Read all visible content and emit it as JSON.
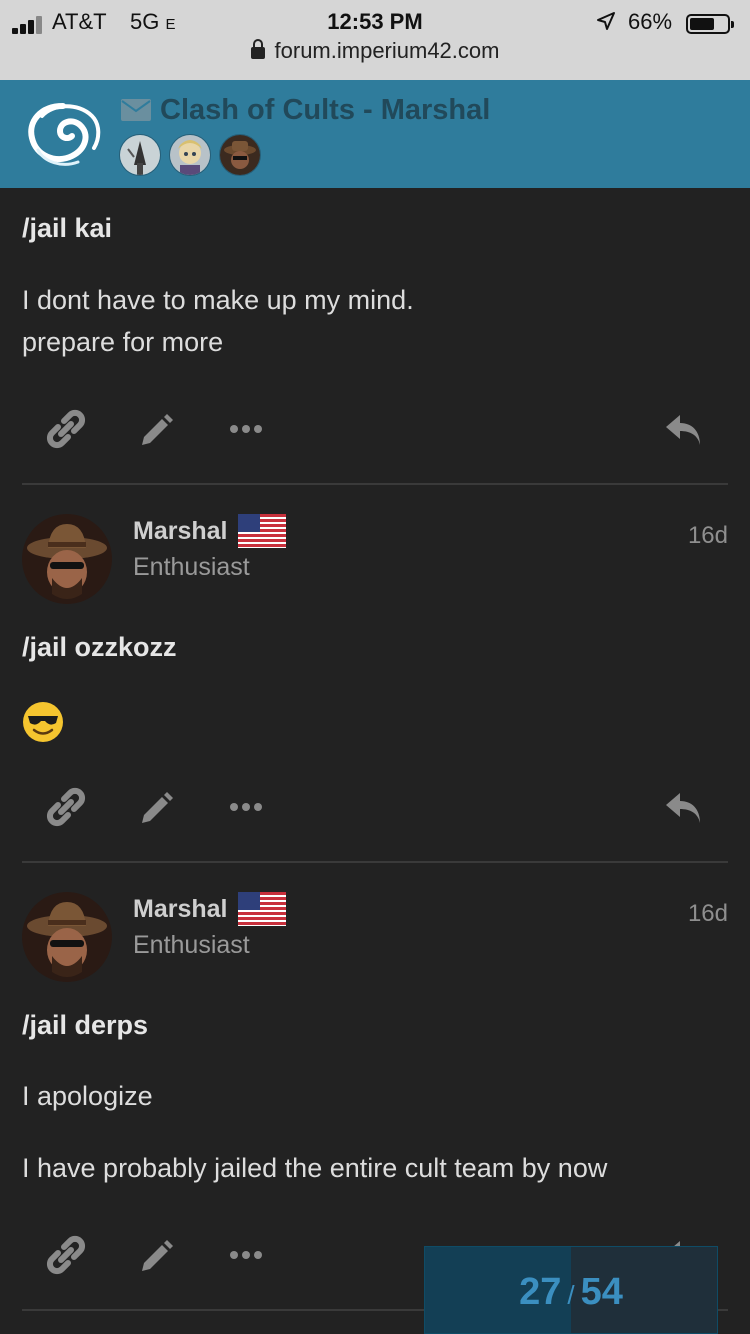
{
  "status_bar": {
    "carrier": "AT&T",
    "network": "5G",
    "network_suffix": "E",
    "time": "12:53 PM",
    "battery_percent": "66%",
    "battery_level": 0.66,
    "url": "forum.imperium42.com"
  },
  "header": {
    "topic_title": "Clash of Cults - Marshal",
    "title_color": "#21495a",
    "bar_color": "#2f7c9c",
    "participants": [
      "participant-avatar-1",
      "participant-avatar-2",
      "participant-avatar-3"
    ]
  },
  "posts": [
    {
      "heading": "/jail kai",
      "lines": [
        "I dont have to make up my mind.",
        "prepare for more"
      ],
      "actions": [
        "link-icon",
        "pencil-icon",
        "more-icon",
        "reply-icon"
      ]
    },
    {
      "username": "Marshal",
      "user_title": "Enthusiast",
      "date": "16d",
      "heading": "/jail ozzkozz",
      "emoji": "sunglasses-emoji",
      "actions": [
        "link-icon",
        "pencil-icon",
        "more-icon",
        "reply-icon"
      ]
    },
    {
      "username": "Marshal",
      "user_title": "Enthusiast",
      "date": "16d",
      "heading": "/jail derps",
      "lines": [
        "I apologize",
        "I have probably jailed the entire cult team by now"
      ],
      "actions": [
        "link-icon",
        "pencil-icon",
        "more-icon",
        "reply-icon"
      ]
    }
  ],
  "timeline": {
    "current": "27",
    "separator": "/",
    "total": "54",
    "progress_fraction": 0.5
  }
}
